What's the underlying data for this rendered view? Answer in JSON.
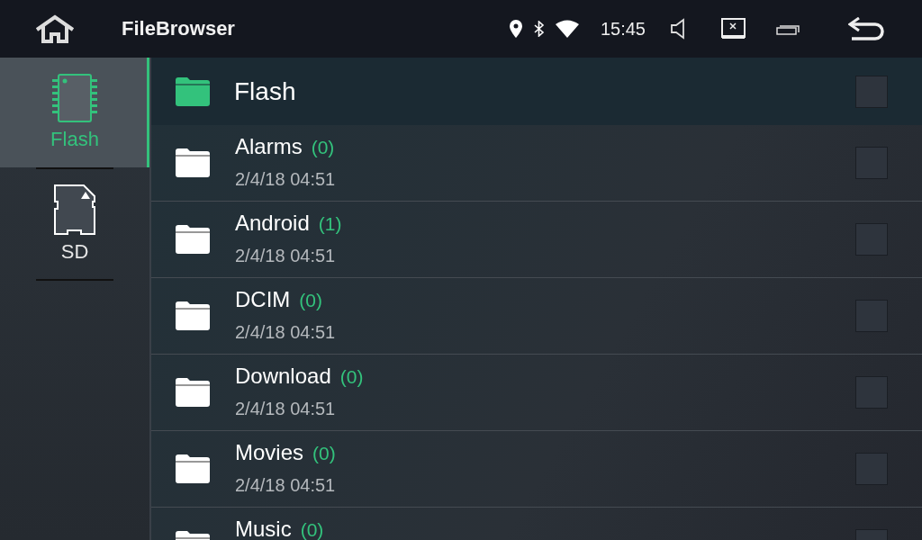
{
  "top_bar": {
    "title": "FileBrowser",
    "time": "15:45"
  },
  "sidebar": {
    "items": [
      {
        "kind": "flash",
        "label": "Flash",
        "selected": true
      },
      {
        "kind": "sd",
        "label": "SD",
        "selected": false
      }
    ]
  },
  "location": {
    "name": "Flash",
    "checked": false
  },
  "files": [
    {
      "name": "Alarms",
      "count": "(0)",
      "date": "2/4/18 04:51",
      "checked": false
    },
    {
      "name": "Android",
      "count": "(1)",
      "date": "2/4/18 04:51",
      "checked": false
    },
    {
      "name": "DCIM",
      "count": "(0)",
      "date": "2/4/18 04:51",
      "checked": false
    },
    {
      "name": "Download",
      "count": "(0)",
      "date": "2/4/18 04:51",
      "checked": false
    },
    {
      "name": "Movies",
      "count": "(0)",
      "date": "2/4/18 04:51",
      "checked": false
    },
    {
      "name": "Music",
      "count": "(0)",
      "checked": false
    }
  ]
}
